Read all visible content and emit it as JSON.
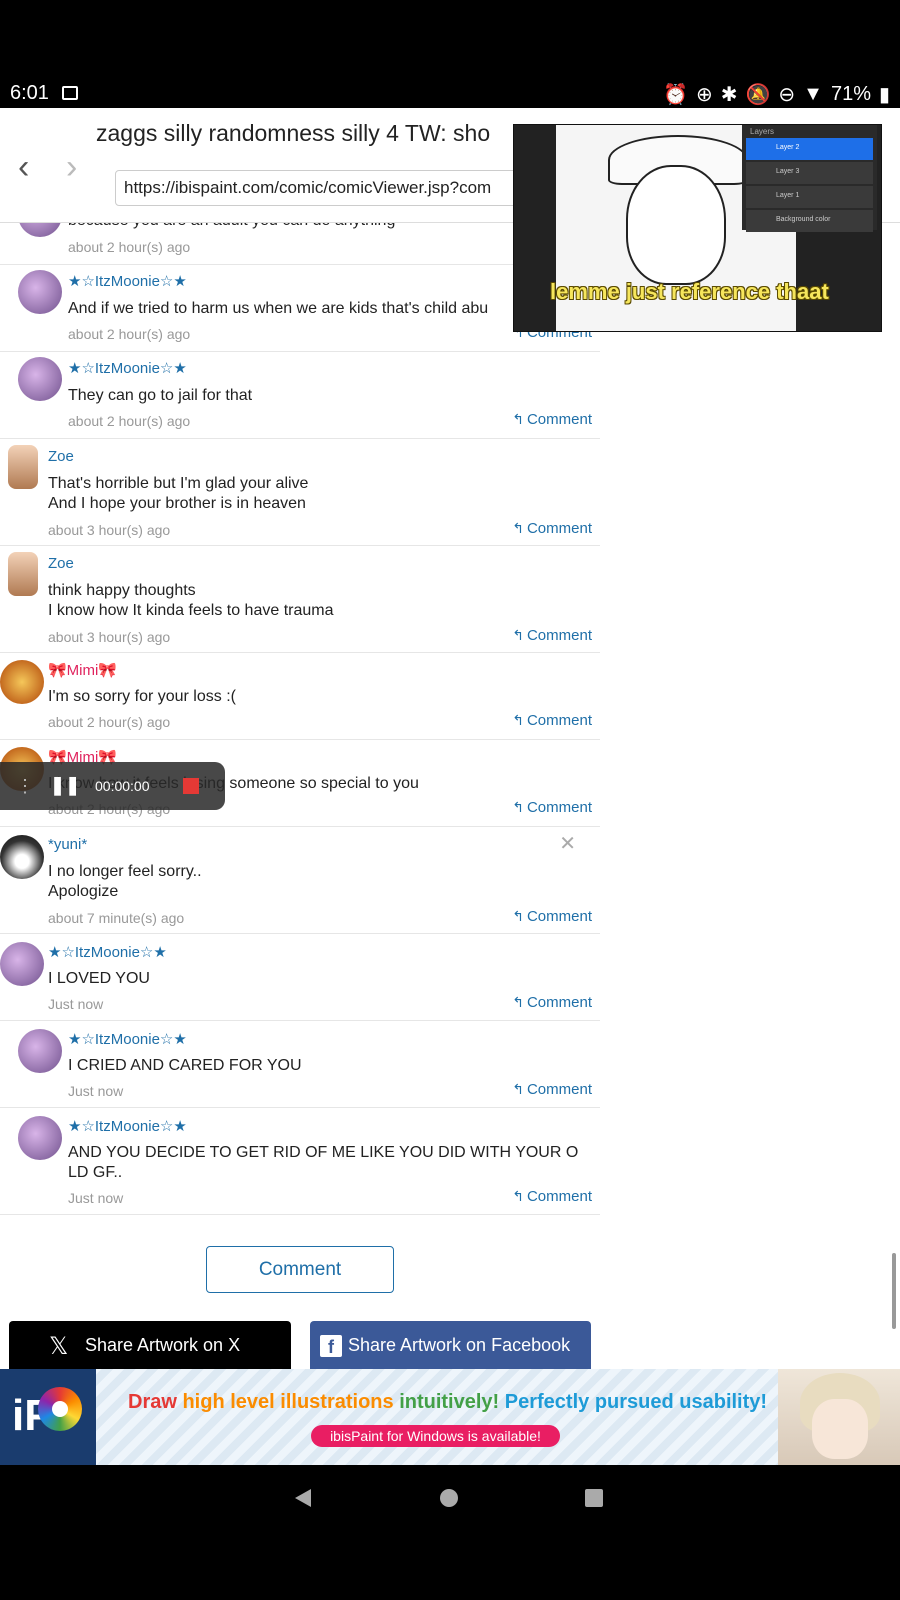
{
  "status": {
    "time": "6:01",
    "battery": "71%"
  },
  "browser": {
    "page_title": "zaggs silly randomness silly 4 TW: sho",
    "url": "https://ibispaint.com/comic/comicViewer.jsp?com",
    "back_glyph": "‹",
    "forward_glyph": "›"
  },
  "comments": [
    {
      "name": "",
      "text": "because you are an adult you can do anything",
      "time": "about 2 hour(s) ago",
      "reply": ""
    },
    {
      "name": "★☆ItzMoonie☆★",
      "text": "And if we tried to harm us when we are kids that's child abu",
      "time": "about 2 hour(s) ago",
      "reply": "Comment"
    },
    {
      "name": "★☆ItzMoonie☆★",
      "text": "They can go to jail for that",
      "time": "about 2 hour(s) ago",
      "reply": "Comment"
    },
    {
      "name": "Zoe",
      "text": "That's horrible but I'm glad your alive\nAnd I hope your brother is in heaven",
      "time": "about 3 hour(s) ago",
      "reply": "Comment"
    },
    {
      "name": "Zoe",
      "text": "think happy thoughts\nI know how It kinda feels to have trauma",
      "time": "about 3 hour(s) ago",
      "reply": "Comment"
    },
    {
      "name": "🎀Mimi🎀",
      "text": "I'm so sorry for your loss :(",
      "time": "about 2 hour(s) ago",
      "reply": "Comment"
    },
    {
      "name": "🎀Mimi🎀",
      "text": "I know how it feels losing someone so special to you",
      "time": "about 2 hour(s) ago",
      "reply": "Comment"
    },
    {
      "name": "*yuni*",
      "text": "I no longer feel sorry..\nApologize",
      "time": "about 7 minute(s) ago",
      "reply": "Comment"
    },
    {
      "name": "★☆ItzMoonie☆★",
      "text": "I LOVED YOU",
      "time": "Just now",
      "reply": "Comment"
    },
    {
      "name": "★☆ItzMoonie☆★",
      "text": "I CRIED AND CARED FOR YOU",
      "time": "Just now",
      "reply": "Comment"
    },
    {
      "name": "★☆ItzMoonie☆★",
      "text": "AND YOU DECIDE TO GET RID OF ME LIKE YOU DID WITH YOUR O\nLD GF..",
      "time": "Just now",
      "reply": "Comment"
    }
  ],
  "comment_button": "Comment",
  "share": {
    "x_label": "Share Artwork on X",
    "fb_label": "Share Artwork on Facebook"
  },
  "pip_video": {
    "caption": "lemme just reference thaat",
    "layers_title": "Layers",
    "layers": [
      "Layer 2",
      "Layer 3",
      "Layer 1",
      "Background color"
    ]
  },
  "recorder": {
    "time": "00:00:00"
  },
  "ad": {
    "logo": "iP",
    "headline_1": "Draw",
    "headline_2": "high level illustrations",
    "headline_3": "intuitively!",
    "headline_4": "Perfectly pursued usability!",
    "pill": "ibisPaint for Windows is available!"
  },
  "colors": {
    "link_blue": "#1f6fa8",
    "facebook_blue": "#3b5998",
    "ad_pink": "#e91e63",
    "caption_yellow": "#f6e65c"
  }
}
